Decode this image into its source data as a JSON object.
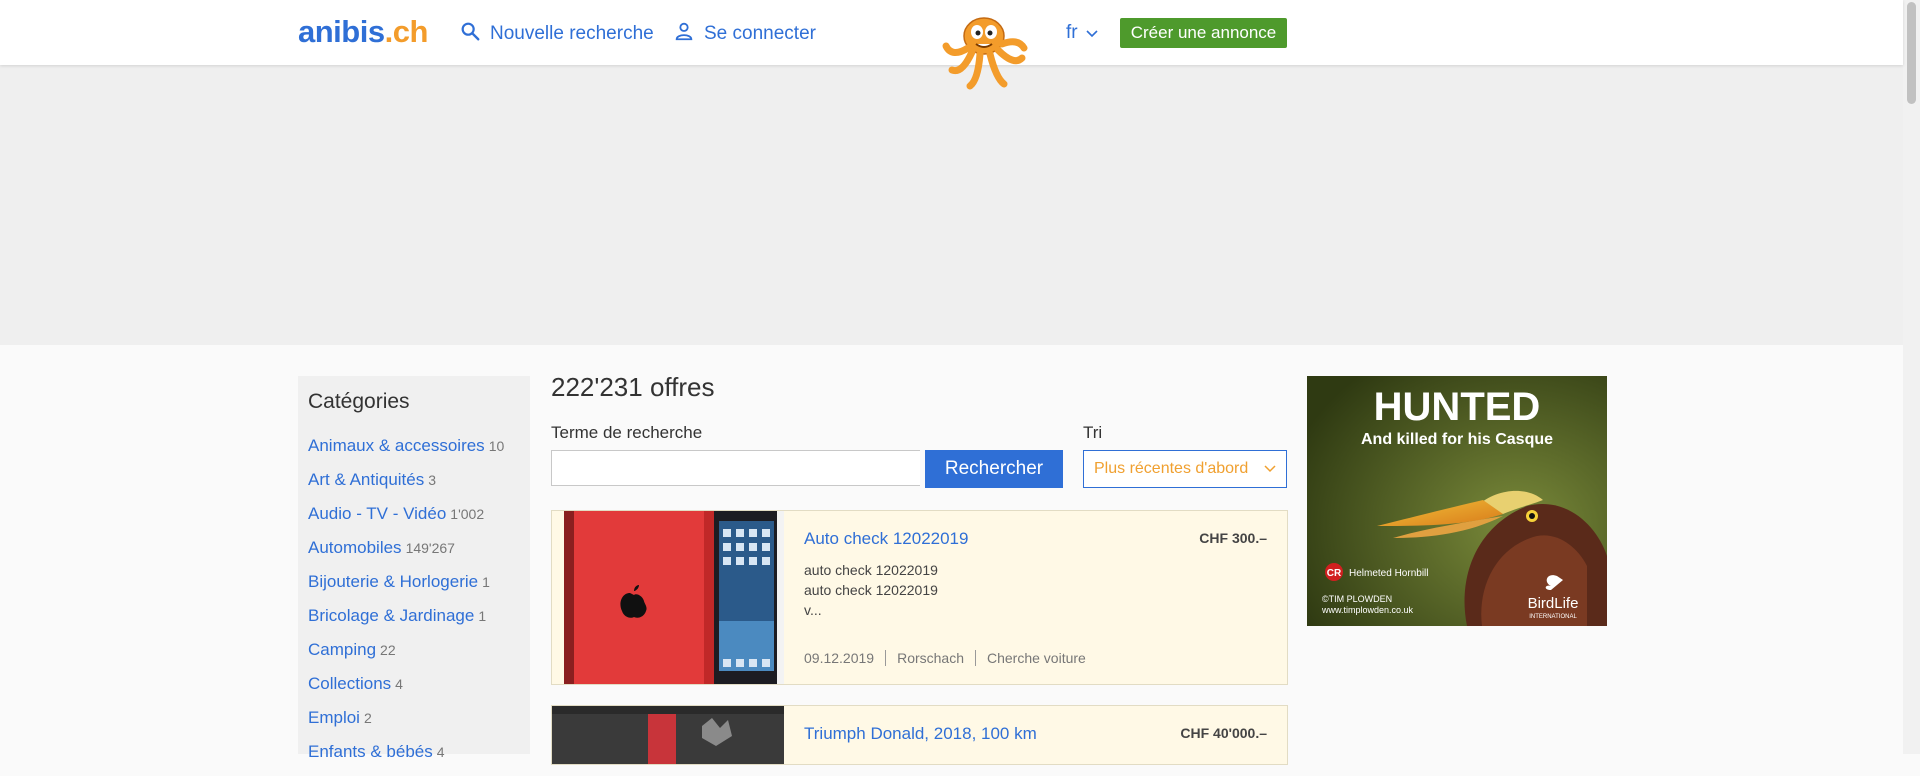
{
  "header": {
    "logo_main": "anibis",
    "logo_tld": ".ch",
    "new_search": "Nouvelle recherche",
    "login": "Se connecter",
    "language": "fr",
    "create_ad": "Créer une annonce"
  },
  "sidebar": {
    "title": "Catégories",
    "categories": [
      {
        "name": "Animaux & accessoires",
        "count": "10"
      },
      {
        "name": "Art & Antiquités",
        "count": "3"
      },
      {
        "name": "Audio - TV - Vidéo",
        "count": "1'002"
      },
      {
        "name": "Automobiles",
        "count": "149'267"
      },
      {
        "name": "Bijouterie & Horlogerie",
        "count": "1"
      },
      {
        "name": "Bricolage & Jardinage",
        "count": "1"
      },
      {
        "name": "Camping",
        "count": "22"
      },
      {
        "name": "Collections",
        "count": "4"
      },
      {
        "name": "Emploi",
        "count": "2"
      },
      {
        "name": "Enfants & bébés",
        "count": "4"
      }
    ]
  },
  "main": {
    "offers_count": "222'231 offres",
    "search_label": "Terme de recherche",
    "search_value": "",
    "search_button": "Rechercher",
    "sort_label": "Tri",
    "sort_value": "Plus récentes d'abord"
  },
  "listings": [
    {
      "title": "Auto check 12022019",
      "price": "CHF 300.–",
      "desc_line1": "auto check 12022019",
      "desc_line2": "auto check 12022019",
      "desc_line3": "v...",
      "date": "09.12.2019",
      "location": "Rorschach",
      "category": "Cherche voiture"
    },
    {
      "title": "Triumph Donald, 2018, 100 km",
      "price": "CHF 40'000.–"
    }
  ],
  "side_ad": {
    "headline": "HUNTED",
    "subline": "And killed for his Casque",
    "cr_badge": "CR",
    "species": "Helmeted Hornbill",
    "credit1": "©TIM PLOWDEN",
    "credit2": "www.timplowden.co.uk",
    "brand": "BirdLife",
    "brand_sub": "INTERNATIONAL"
  },
  "colors": {
    "link": "#2f6fd6",
    "accent_orange": "#f39c2b",
    "create_button": "#4e9a2c",
    "listing_bg": "#fff9e6"
  },
  "icons": [
    "search-icon",
    "user-icon",
    "chevron-down-icon",
    "mascot-octopus-icon"
  ]
}
